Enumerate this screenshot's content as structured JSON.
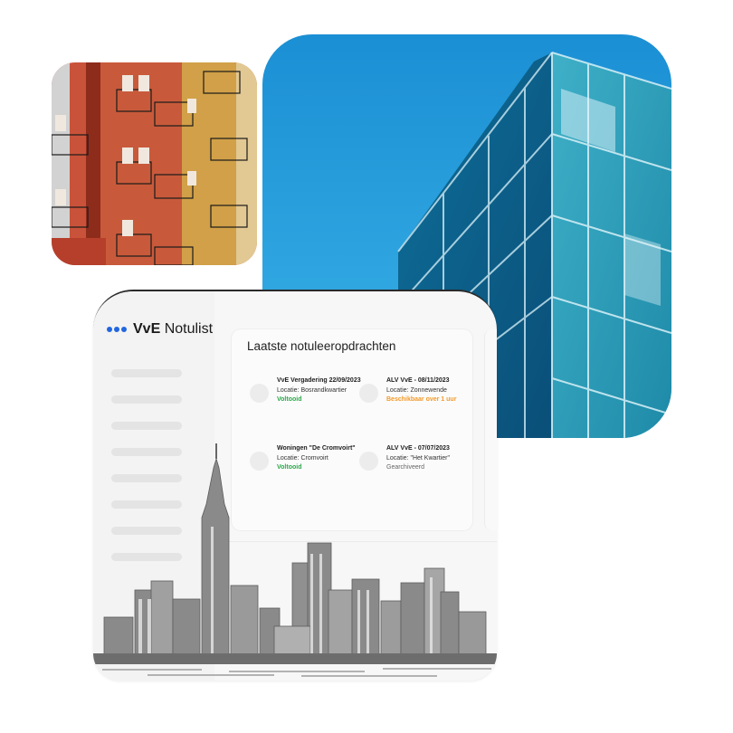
{
  "photos": {
    "apartments": "colorful-apartment-building-photo",
    "glass": "glass-office-building-photo"
  },
  "app": {
    "logo_text_bold": "VvE",
    "logo_text": "Notulist",
    "panel_title": "Laatste notuleeropdrachten",
    "tasks": [
      {
        "title": "VvE Vergadering 22/09/2023",
        "location": "Locatie: Bosrandkwartier",
        "status": "Voltooid"
      },
      {
        "title": "ALV VvE - 08/11/2023",
        "location": "Locatie: Zonnewende",
        "status": "Beschikbaar over 1 uur"
      },
      {
        "title": "Woningen \"De Cromvoirt\"",
        "location": "Locatie: Cromvoirt",
        "status": "Voltooid"
      },
      {
        "title": "ALV VvE - 07/07/2023",
        "location": "Locatie: \"Het Kwartier\"",
        "status": "Gearchiveerd"
      }
    ]
  },
  "colors": {
    "accent": "#2266e0",
    "status_done": "#2ba84a",
    "status_upcoming": "#f39a2a",
    "status_archived": "#666666",
    "sky": "#1a9ad6",
    "skyline": "#8a8a8a"
  }
}
